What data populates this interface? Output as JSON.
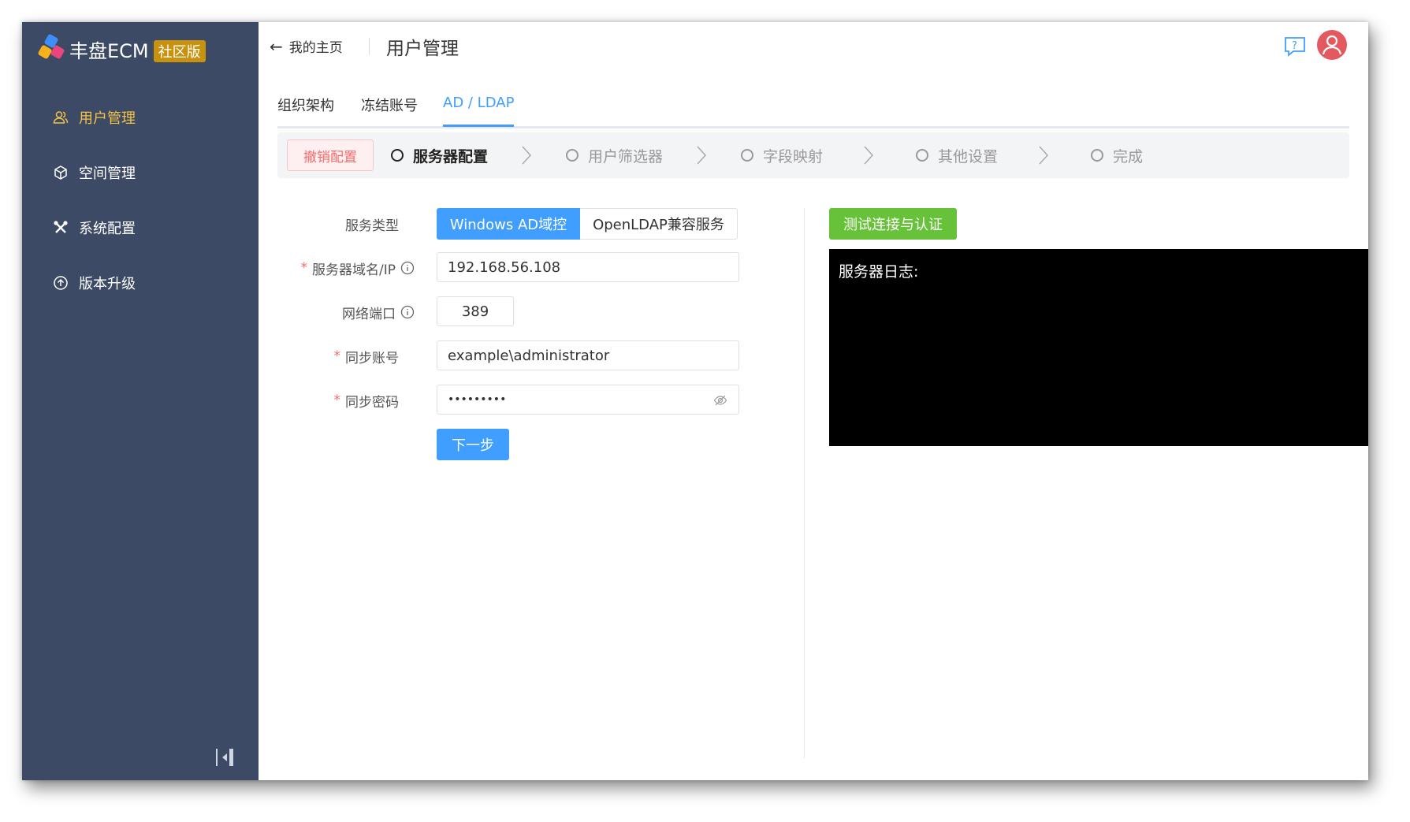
{
  "app": {
    "name": "丰盘ECM",
    "edition_badge": "社区版"
  },
  "sidebar": {
    "items": [
      {
        "label": "用户管理",
        "icon": "users-icon",
        "active": true
      },
      {
        "label": "空间管理",
        "icon": "cube-icon",
        "active": false
      },
      {
        "label": "系统配置",
        "icon": "tools-icon",
        "active": false
      },
      {
        "label": "版本升级",
        "icon": "upgrade-icon",
        "active": false
      }
    ],
    "active_color": "#f5c343",
    "background": "#3d4a66"
  },
  "header": {
    "back_label": "我的主页",
    "title": "用户管理"
  },
  "tabs": [
    {
      "label": "组织架构",
      "active": false
    },
    {
      "label": "冻结账号",
      "active": false
    },
    {
      "label": "AD / LDAP",
      "active": true
    }
  ],
  "steps": {
    "cancel_label": "撤销配置",
    "items": [
      {
        "label": "服务器配置",
        "current": true
      },
      {
        "label": "用户筛选器",
        "current": false
      },
      {
        "label": "字段映射",
        "current": false
      },
      {
        "label": "其他设置",
        "current": false
      },
      {
        "label": "完成",
        "current": false
      }
    ]
  },
  "form": {
    "service_type": {
      "label": "服务类型",
      "options": [
        "Windows AD域控",
        "OpenLDAP兼容服务"
      ],
      "selected": "Windows AD域控"
    },
    "server": {
      "label": "服务器域名/IP",
      "required": true,
      "value": "192.168.56.108"
    },
    "port": {
      "label": "网络端口",
      "required": false,
      "value": "389"
    },
    "account": {
      "label": "同步账号",
      "required": true,
      "value": "example\\administrator"
    },
    "password": {
      "label": "同步密码",
      "required": true,
      "value": "•••••••••"
    },
    "next_label": "下一步"
  },
  "right_panel": {
    "test_button_label": "测试连接与认证",
    "log_title": "服务器日志:"
  },
  "colors": {
    "primary": "#409eff",
    "success": "#67c23a",
    "danger": "#f56c6c"
  }
}
